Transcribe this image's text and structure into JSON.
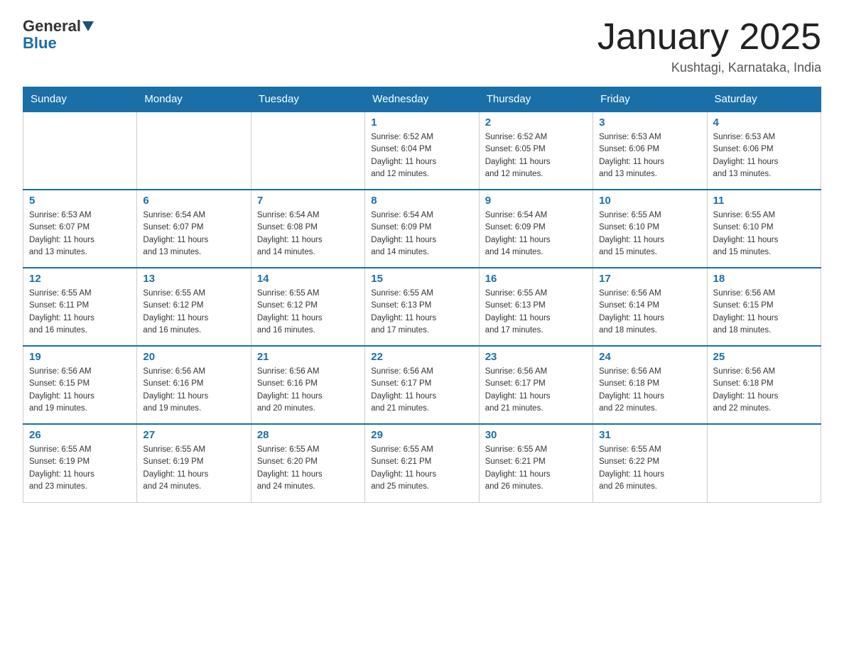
{
  "header": {
    "logo_general": "General",
    "logo_blue": "Blue",
    "month_title": "January 2025",
    "location": "Kushtagi, Karnataka, India"
  },
  "days_of_week": [
    "Sunday",
    "Monday",
    "Tuesday",
    "Wednesday",
    "Thursday",
    "Friday",
    "Saturday"
  ],
  "weeks": [
    [
      {
        "day": "",
        "info": ""
      },
      {
        "day": "",
        "info": ""
      },
      {
        "day": "",
        "info": ""
      },
      {
        "day": "1",
        "info": "Sunrise: 6:52 AM\nSunset: 6:04 PM\nDaylight: 11 hours\nand 12 minutes."
      },
      {
        "day": "2",
        "info": "Sunrise: 6:52 AM\nSunset: 6:05 PM\nDaylight: 11 hours\nand 12 minutes."
      },
      {
        "day": "3",
        "info": "Sunrise: 6:53 AM\nSunset: 6:06 PM\nDaylight: 11 hours\nand 13 minutes."
      },
      {
        "day": "4",
        "info": "Sunrise: 6:53 AM\nSunset: 6:06 PM\nDaylight: 11 hours\nand 13 minutes."
      }
    ],
    [
      {
        "day": "5",
        "info": "Sunrise: 6:53 AM\nSunset: 6:07 PM\nDaylight: 11 hours\nand 13 minutes."
      },
      {
        "day": "6",
        "info": "Sunrise: 6:54 AM\nSunset: 6:07 PM\nDaylight: 11 hours\nand 13 minutes."
      },
      {
        "day": "7",
        "info": "Sunrise: 6:54 AM\nSunset: 6:08 PM\nDaylight: 11 hours\nand 14 minutes."
      },
      {
        "day": "8",
        "info": "Sunrise: 6:54 AM\nSunset: 6:09 PM\nDaylight: 11 hours\nand 14 minutes."
      },
      {
        "day": "9",
        "info": "Sunrise: 6:54 AM\nSunset: 6:09 PM\nDaylight: 11 hours\nand 14 minutes."
      },
      {
        "day": "10",
        "info": "Sunrise: 6:55 AM\nSunset: 6:10 PM\nDaylight: 11 hours\nand 15 minutes."
      },
      {
        "day": "11",
        "info": "Sunrise: 6:55 AM\nSunset: 6:10 PM\nDaylight: 11 hours\nand 15 minutes."
      }
    ],
    [
      {
        "day": "12",
        "info": "Sunrise: 6:55 AM\nSunset: 6:11 PM\nDaylight: 11 hours\nand 16 minutes."
      },
      {
        "day": "13",
        "info": "Sunrise: 6:55 AM\nSunset: 6:12 PM\nDaylight: 11 hours\nand 16 minutes."
      },
      {
        "day": "14",
        "info": "Sunrise: 6:55 AM\nSunset: 6:12 PM\nDaylight: 11 hours\nand 16 minutes."
      },
      {
        "day": "15",
        "info": "Sunrise: 6:55 AM\nSunset: 6:13 PM\nDaylight: 11 hours\nand 17 minutes."
      },
      {
        "day": "16",
        "info": "Sunrise: 6:55 AM\nSunset: 6:13 PM\nDaylight: 11 hours\nand 17 minutes."
      },
      {
        "day": "17",
        "info": "Sunrise: 6:56 AM\nSunset: 6:14 PM\nDaylight: 11 hours\nand 18 minutes."
      },
      {
        "day": "18",
        "info": "Sunrise: 6:56 AM\nSunset: 6:15 PM\nDaylight: 11 hours\nand 18 minutes."
      }
    ],
    [
      {
        "day": "19",
        "info": "Sunrise: 6:56 AM\nSunset: 6:15 PM\nDaylight: 11 hours\nand 19 minutes."
      },
      {
        "day": "20",
        "info": "Sunrise: 6:56 AM\nSunset: 6:16 PM\nDaylight: 11 hours\nand 19 minutes."
      },
      {
        "day": "21",
        "info": "Sunrise: 6:56 AM\nSunset: 6:16 PM\nDaylight: 11 hours\nand 20 minutes."
      },
      {
        "day": "22",
        "info": "Sunrise: 6:56 AM\nSunset: 6:17 PM\nDaylight: 11 hours\nand 21 minutes."
      },
      {
        "day": "23",
        "info": "Sunrise: 6:56 AM\nSunset: 6:17 PM\nDaylight: 11 hours\nand 21 minutes."
      },
      {
        "day": "24",
        "info": "Sunrise: 6:56 AM\nSunset: 6:18 PM\nDaylight: 11 hours\nand 22 minutes."
      },
      {
        "day": "25",
        "info": "Sunrise: 6:56 AM\nSunset: 6:18 PM\nDaylight: 11 hours\nand 22 minutes."
      }
    ],
    [
      {
        "day": "26",
        "info": "Sunrise: 6:55 AM\nSunset: 6:19 PM\nDaylight: 11 hours\nand 23 minutes."
      },
      {
        "day": "27",
        "info": "Sunrise: 6:55 AM\nSunset: 6:19 PM\nDaylight: 11 hours\nand 24 minutes."
      },
      {
        "day": "28",
        "info": "Sunrise: 6:55 AM\nSunset: 6:20 PM\nDaylight: 11 hours\nand 24 minutes."
      },
      {
        "day": "29",
        "info": "Sunrise: 6:55 AM\nSunset: 6:21 PM\nDaylight: 11 hours\nand 25 minutes."
      },
      {
        "day": "30",
        "info": "Sunrise: 6:55 AM\nSunset: 6:21 PM\nDaylight: 11 hours\nand 26 minutes."
      },
      {
        "day": "31",
        "info": "Sunrise: 6:55 AM\nSunset: 6:22 PM\nDaylight: 11 hours\nand 26 minutes."
      },
      {
        "day": "",
        "info": ""
      }
    ]
  ]
}
